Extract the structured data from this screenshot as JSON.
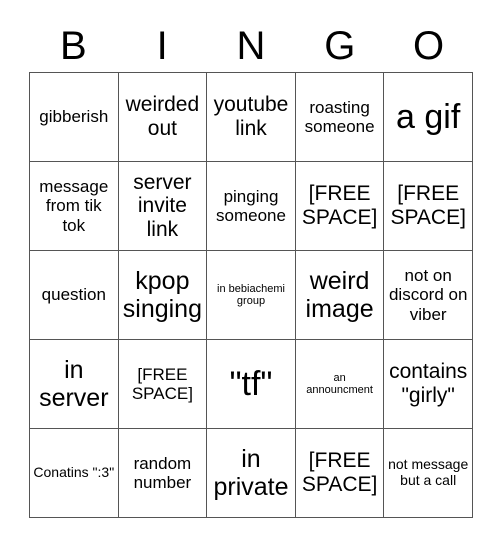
{
  "card": {
    "title": "BINGO",
    "columns": [
      "B",
      "I",
      "N",
      "G",
      "O"
    ],
    "grid_size": "5x5",
    "border_color": "#555555",
    "text_color": "#000000",
    "background_color": "#ffffff",
    "free_space_label": "[FREE SPACE]",
    "cells": [
      {
        "text": "gibberish",
        "size": "fs-md",
        "free": false
      },
      {
        "text": "weirded out",
        "size": "fs-lg",
        "free": false
      },
      {
        "text": "youtube link",
        "size": "fs-lg",
        "free": false
      },
      {
        "text": "roasting someone",
        "size": "fs-md",
        "free": false
      },
      {
        "text": "a gif",
        "size": "fs-xxl",
        "free": false
      },
      {
        "text": "message from tik tok",
        "size": "fs-md",
        "free": false
      },
      {
        "text": "server invite link",
        "size": "fs-lg",
        "free": false
      },
      {
        "text": "pinging someone",
        "size": "fs-md",
        "free": false
      },
      {
        "text": "[FREE SPACE]",
        "size": "fs-lg",
        "free": true
      },
      {
        "text": "[FREE SPACE]",
        "size": "fs-lg",
        "free": true
      },
      {
        "text": "question",
        "size": "fs-md",
        "free": false
      },
      {
        "text": "kpop singing",
        "size": "fs-xl",
        "free": false
      },
      {
        "text": "in bebiachemi group",
        "size": "fs-xs",
        "free": false
      },
      {
        "text": "weird image",
        "size": "fs-xl",
        "free": false
      },
      {
        "text": "not on discord on viber",
        "size": "fs-md",
        "free": false
      },
      {
        "text": "in server",
        "size": "fs-xl",
        "free": false
      },
      {
        "text": "[FREE SPACE]",
        "size": "fs-md",
        "free": true
      },
      {
        "text": "\"tf\"",
        "size": "fs-xxl",
        "free": false
      },
      {
        "text": "an announcment",
        "size": "fs-xs",
        "free": false
      },
      {
        "text": "contains \"girly\"",
        "size": "fs-lg",
        "free": false
      },
      {
        "text": "Conatins \":3\"",
        "size": "fs-sm",
        "free": false
      },
      {
        "text": "random number",
        "size": "fs-md",
        "free": false
      },
      {
        "text": "in private",
        "size": "fs-xl",
        "free": false
      },
      {
        "text": "[FREE SPACE]",
        "size": "fs-lg",
        "free": true
      },
      {
        "text": "not message but a call",
        "size": "fs-sm",
        "free": false
      }
    ]
  }
}
